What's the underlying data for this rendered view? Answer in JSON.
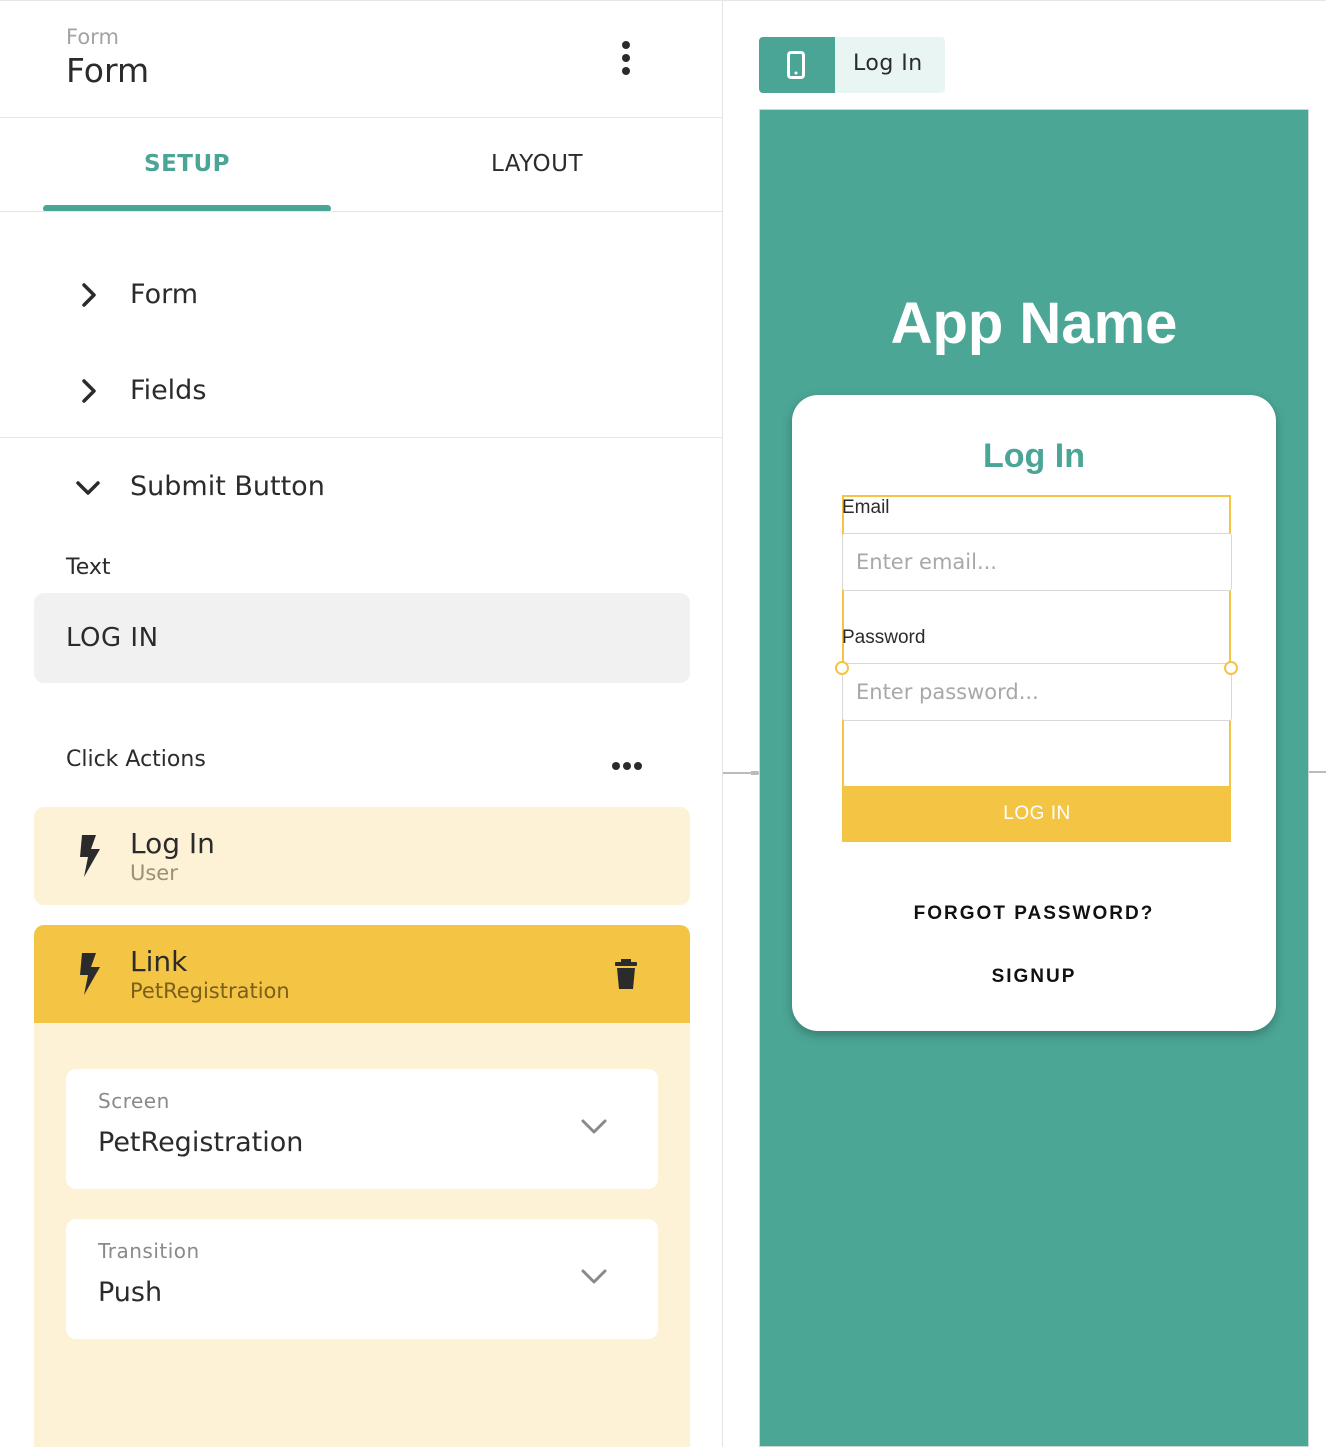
{
  "header": {
    "subtitle": "Form",
    "title": "Form"
  },
  "tabs": {
    "setup": "SETUP",
    "layout": "LAYOUT"
  },
  "sections": {
    "form": "Form",
    "fields": "Fields",
    "submit_button": "Submit Button"
  },
  "text_field": {
    "label": "Text",
    "value": "LOG IN"
  },
  "click_actions": {
    "label": "Click Actions",
    "items": [
      {
        "title": "Log In",
        "subtitle": "User"
      },
      {
        "title": "Link",
        "subtitle": "PetRegistration"
      }
    ]
  },
  "link_settings": {
    "screen": {
      "label": "Screen",
      "value": "PetRegistration"
    },
    "transition": {
      "label": "Transition",
      "value": "Push"
    }
  },
  "canvas": {
    "screen_tab_label": "Log In",
    "app_name": "App Name",
    "card_title": "Log In",
    "email_label": "Email",
    "email_placeholder": "Enter email...",
    "password_label": "Password",
    "password_placeholder": "Enter password...",
    "submit_label": "LOG IN",
    "forgot_label": "FORGOT PASSWORD?",
    "signup_label": "SIGNUP"
  },
  "colors": {
    "accent": "#4aa596",
    "canvas_bg": "#4ba696",
    "highlight": "#f4c444",
    "highlight_light": "#fdf1d6"
  },
  "icons": [
    "kebab-menu-icon",
    "chevron-right-icon",
    "chevron-down-icon",
    "more-horizontal-icon",
    "lightning-bolt-icon",
    "trash-icon",
    "phone-icon"
  ]
}
